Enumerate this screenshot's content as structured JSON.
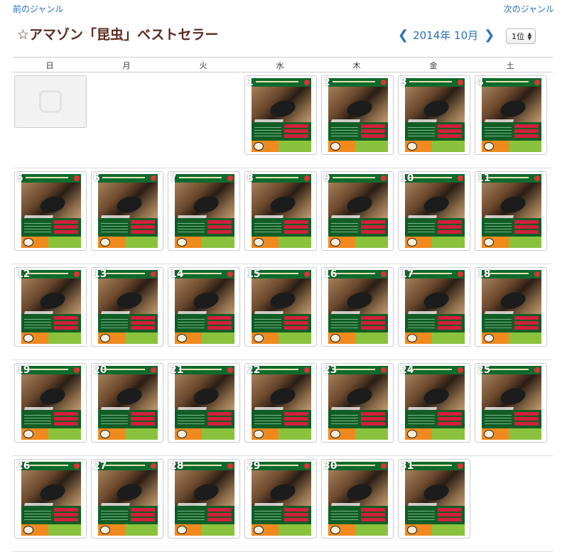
{
  "nav": {
    "prev_label": "前のジャンル",
    "next_label": "次のジャンル"
  },
  "title": "☆アマゾン「昆虫」ベストセラー",
  "month_nav": {
    "label": "2014年 10月"
  },
  "rank_select": {
    "value": "1位"
  },
  "weekdays": [
    "日",
    "月",
    "火",
    "水",
    "木",
    "金",
    "土"
  ],
  "weeks": [
    [
      {
        "placeholder": true
      },
      null,
      null,
      {
        "day": "1"
      },
      {
        "day": "2"
      },
      {
        "day": "3"
      },
      {
        "day": "4"
      }
    ],
    [
      {
        "day": "5"
      },
      {
        "day": "6"
      },
      {
        "day": "7"
      },
      {
        "day": "8"
      },
      {
        "day": "9"
      },
      {
        "day": "10"
      },
      {
        "day": "11"
      }
    ],
    [
      {
        "day": "12"
      },
      {
        "day": "13"
      },
      {
        "day": "14"
      },
      {
        "day": "15"
      },
      {
        "day": "16"
      },
      {
        "day": "17"
      },
      {
        "day": "18"
      }
    ],
    [
      {
        "day": "19"
      },
      {
        "day": "20"
      },
      {
        "day": "21"
      },
      {
        "day": "22"
      },
      {
        "day": "23"
      },
      {
        "day": "24"
      },
      {
        "day": "25"
      }
    ],
    [
      {
        "day": "26"
      },
      {
        "day": "27"
      },
      {
        "day": "28"
      },
      {
        "day": "29"
      },
      {
        "day": "30"
      },
      {
        "day": "31"
      },
      null
    ]
  ],
  "colors": {
    "link": "#2a6fb8",
    "title": "#5a2a1e"
  },
  "icons": {
    "prev_month": "chevron-left-icon",
    "next_month": "chevron-right-icon",
    "select": "updown-arrows-icon"
  }
}
